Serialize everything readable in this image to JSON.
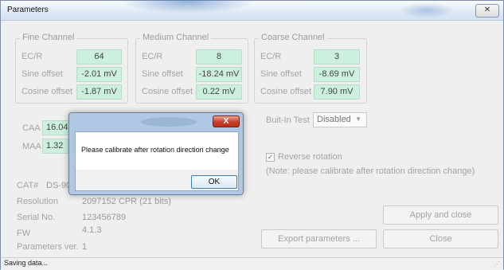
{
  "window": {
    "title": "Parameters",
    "close_glyph": "✕"
  },
  "fine": {
    "title": "Fine Channel",
    "ecr_label": "EC/R",
    "ecr": "64",
    "sine_label": "Sine offset",
    "sine": "-2.01 mV",
    "cos_label": "Cosine offset",
    "cos": "-1.87 mV"
  },
  "medium": {
    "title": "Medium Channel",
    "ecr_label": "EC/R",
    "ecr": "8",
    "sine_label": "Sine offset",
    "sine": "-18.24 mV",
    "cos_label": "Cosine offset",
    "cos": "0.22 mV"
  },
  "coarse": {
    "title": "Coarse Channel",
    "ecr_label": "EC/R",
    "ecr": "3",
    "sine_label": "Sine offset",
    "sine": "-8.69 mV",
    "cos_label": "Cosine offset",
    "cos": "7.90 mV"
  },
  "caa": {
    "label": "CAA",
    "value": "16.04"
  },
  "maa": {
    "label": "MAA",
    "value": "1.32"
  },
  "builtin": {
    "label": "Buit-In Test",
    "value": "Disabled"
  },
  "reverse": {
    "label": "Reverse rotation",
    "checked": true,
    "note": "(Note: please calibrate after rotation direction change)"
  },
  "info": {
    "cat_label": "CAT#",
    "cat": "DS-90",
    "res_label": "Resolution",
    "res": "2097152 CPR (21 bits)",
    "serial_label": "Serial No.",
    "serial": "123456789",
    "fw_label": "FW",
    "fw": "4.1.3",
    "params_label": "Parameters ver.",
    "params": "1"
  },
  "buttons": {
    "apply_close": "Apply and close",
    "export": "Export parameters ...",
    "close": "Close"
  },
  "status": {
    "text": "Saving data..."
  },
  "dialog": {
    "message": "Please calibrate after rotation direction change",
    "ok": "OK",
    "close_glyph": "X"
  }
}
